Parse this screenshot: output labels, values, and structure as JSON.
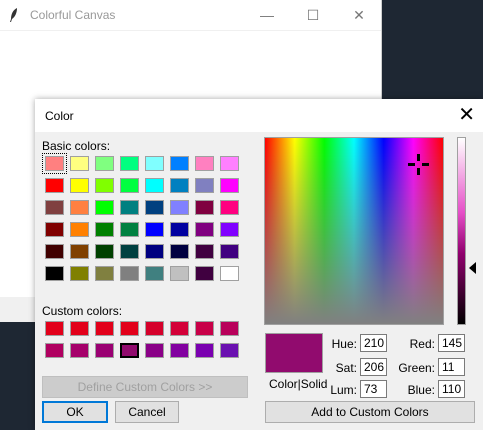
{
  "parent_window": {
    "title": "Colorful Canvas",
    "minimize_glyph": "—",
    "maximize_glyph": "☐",
    "close_glyph": "✕"
  },
  "dialog": {
    "title": "Color",
    "close_glyph": "✕",
    "basic_colors_label": "Basic colors:",
    "custom_colors_label": "Custom colors:",
    "basic_colors": [
      [
        "#ff8080",
        "#ffff80",
        "#80ff80",
        "#00ff80",
        "#80ffff",
        "#0080ff",
        "#ff80c0",
        "#ff80ff"
      ],
      [
        "#ff0000",
        "#ffff00",
        "#80ff00",
        "#00ff40",
        "#00ffff",
        "#0080c0",
        "#8080c0",
        "#ff00ff"
      ],
      [
        "#804040",
        "#ff8040",
        "#00ff00",
        "#008080",
        "#004080",
        "#8080ff",
        "#800040",
        "#ff0080"
      ],
      [
        "#800000",
        "#ff8000",
        "#008000",
        "#008040",
        "#0000ff",
        "#0000a0",
        "#800080",
        "#8000ff"
      ],
      [
        "#400000",
        "#804000",
        "#004000",
        "#004040",
        "#000080",
        "#000040",
        "#400040",
        "#400080"
      ],
      [
        "#000000",
        "#808000",
        "#808040",
        "#808080",
        "#408080",
        "#c0c0c0",
        "#400040",
        "#ffffff"
      ]
    ],
    "custom_colors": [
      [
        "#e2001a",
        "#e2001a",
        "#e2001a",
        "#e2001a",
        "#d5002a",
        "#d30038",
        "#c80048",
        "#b8005a"
      ],
      [
        "#b00060",
        "#a5006a",
        "#9a0072",
        "#910b6e",
        "#8a0087",
        "#8200a0",
        "#7a00b0",
        "#6a10b0"
      ]
    ],
    "define_custom_colors_label": "Define Custom Colors >>",
    "ok_label": "OK",
    "cancel_label": "Cancel",
    "color_solid_label": "Color|Solid",
    "current_color": "#910b6e",
    "hue_label": "Hue:",
    "sat_label": "Sat:",
    "lum_label": "Lum:",
    "red_label": "Red:",
    "green_label": "Green:",
    "blue_label": "Blue:",
    "hue": "210",
    "sat": "206",
    "lum": "73",
    "red": "145",
    "green": "11",
    "blue": "110",
    "add_to_custom_label": "Add to Custom Colors"
  }
}
